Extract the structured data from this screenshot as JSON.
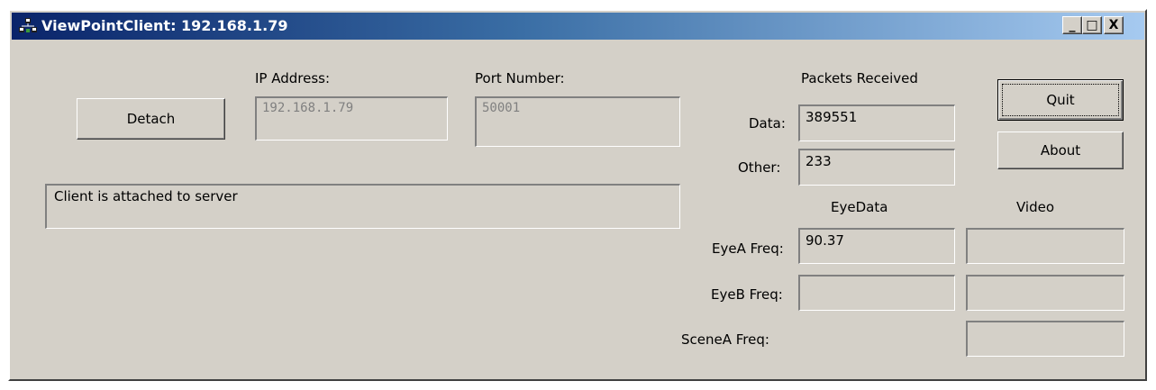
{
  "window": {
    "title": "ViewPointClient: 192.168.1.79",
    "controls": {
      "minimize": "_",
      "maximize": "□",
      "close": "X"
    }
  },
  "connection": {
    "detach_label": "Detach",
    "ip_label": "IP Address:",
    "ip_value": "192.168.1.79",
    "port_label": "Port Number:",
    "port_value": "50001",
    "status_text": "Client is attached to server"
  },
  "packets": {
    "header": "Packets Received",
    "data_label": "Data:",
    "data_value": "389551",
    "other_label": "Other:",
    "other_value": "233"
  },
  "buttons": {
    "quit": "Quit",
    "about": "About"
  },
  "freq": {
    "eyedata_header": "EyeData",
    "video_header": "Video",
    "eyeA_label": "EyeA Freq:",
    "eyeA_value": "90.37",
    "eyeA_video": "",
    "eyeB_label": "EyeB Freq:",
    "eyeB_value": "",
    "eyeB_video": "",
    "sceneA_label": "SceneA Freq:",
    "sceneA_video": ""
  },
  "colors": {
    "face": "#d4d0c8",
    "title_start": "#0a246a",
    "title_end": "#a6caf0"
  }
}
